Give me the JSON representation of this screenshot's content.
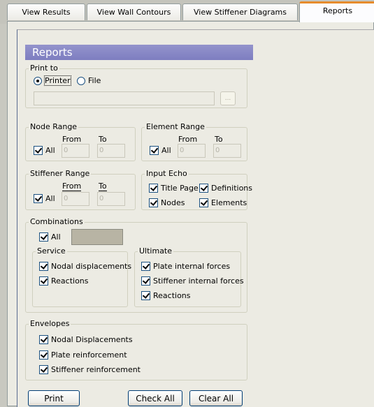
{
  "tabs": [
    {
      "label": "View Results"
    },
    {
      "label": "View Wall Contours"
    },
    {
      "label": "View Stiffener Diagrams"
    },
    {
      "label": "Reports"
    }
  ],
  "header": {
    "title": "Reports"
  },
  "print_to": {
    "legend": "Print to",
    "printer": "Printer",
    "file": "File",
    "browse": "...",
    "selected": "Printer",
    "path": ""
  },
  "node_range": {
    "legend": "Node Range",
    "from": "From",
    "to": "To",
    "all": "All",
    "from_value": "0",
    "to_value": "0"
  },
  "element_range": {
    "legend": "Element Range",
    "from": "From",
    "to": "To",
    "all": "All",
    "from_value": "0",
    "to_value": "0"
  },
  "stiffener_range": {
    "legend": "Stiffener Range",
    "from": "From",
    "to": "To",
    "all": "All",
    "from_value": "0",
    "to_value": "0"
  },
  "input_echo": {
    "legend": "Input Echo",
    "title_page": "Title Page",
    "definitions": "Definitions",
    "nodes": "Nodes",
    "elements": "Elements"
  },
  "combinations": {
    "legend": "Combinations",
    "all": "All",
    "service": {
      "legend": "Service",
      "items": [
        "Nodal displacements",
        "Reactions"
      ]
    },
    "ultimate": {
      "legend": "Ultimate",
      "items": [
        "Plate internal forces",
        "Stiffener internal forces",
        "Reactions"
      ]
    }
  },
  "envelopes": {
    "legend": "Envelopes",
    "items": [
      "Nodal Displacements",
      "Plate reinforcement",
      "Stiffener reinforcement"
    ]
  },
  "buttons": {
    "print": "Print",
    "check_all": "Check All",
    "clear_all": "Clear All"
  }
}
